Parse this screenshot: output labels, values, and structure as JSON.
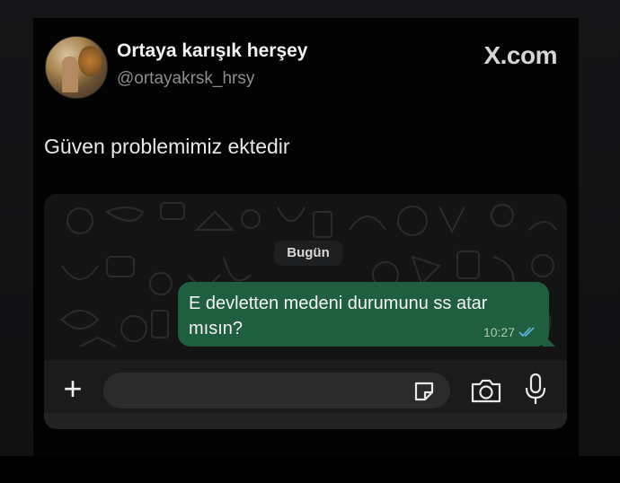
{
  "post": {
    "display_name": "Ortaya karışık herşey",
    "handle": "@ortayakrsk_hrsy",
    "site_label": "X.com",
    "text": "Güven problemimiz ektedir"
  },
  "chat": {
    "date_label": "Bugün",
    "message": {
      "text": "E devletten medeni durumunu ss atar mısın?",
      "time": "10:27",
      "status_icon": "double-check-icon",
      "bubble_color": "#1f5f3f"
    },
    "input": {
      "placeholder": ""
    },
    "icons": [
      "plus-icon",
      "sticker-icon",
      "camera-icon",
      "microphone-icon"
    ]
  },
  "colors": {
    "background": "#030303",
    "text_primary": "#f2f2f2",
    "text_secondary": "#8a8d91",
    "ticks": "#5fb7e8"
  }
}
